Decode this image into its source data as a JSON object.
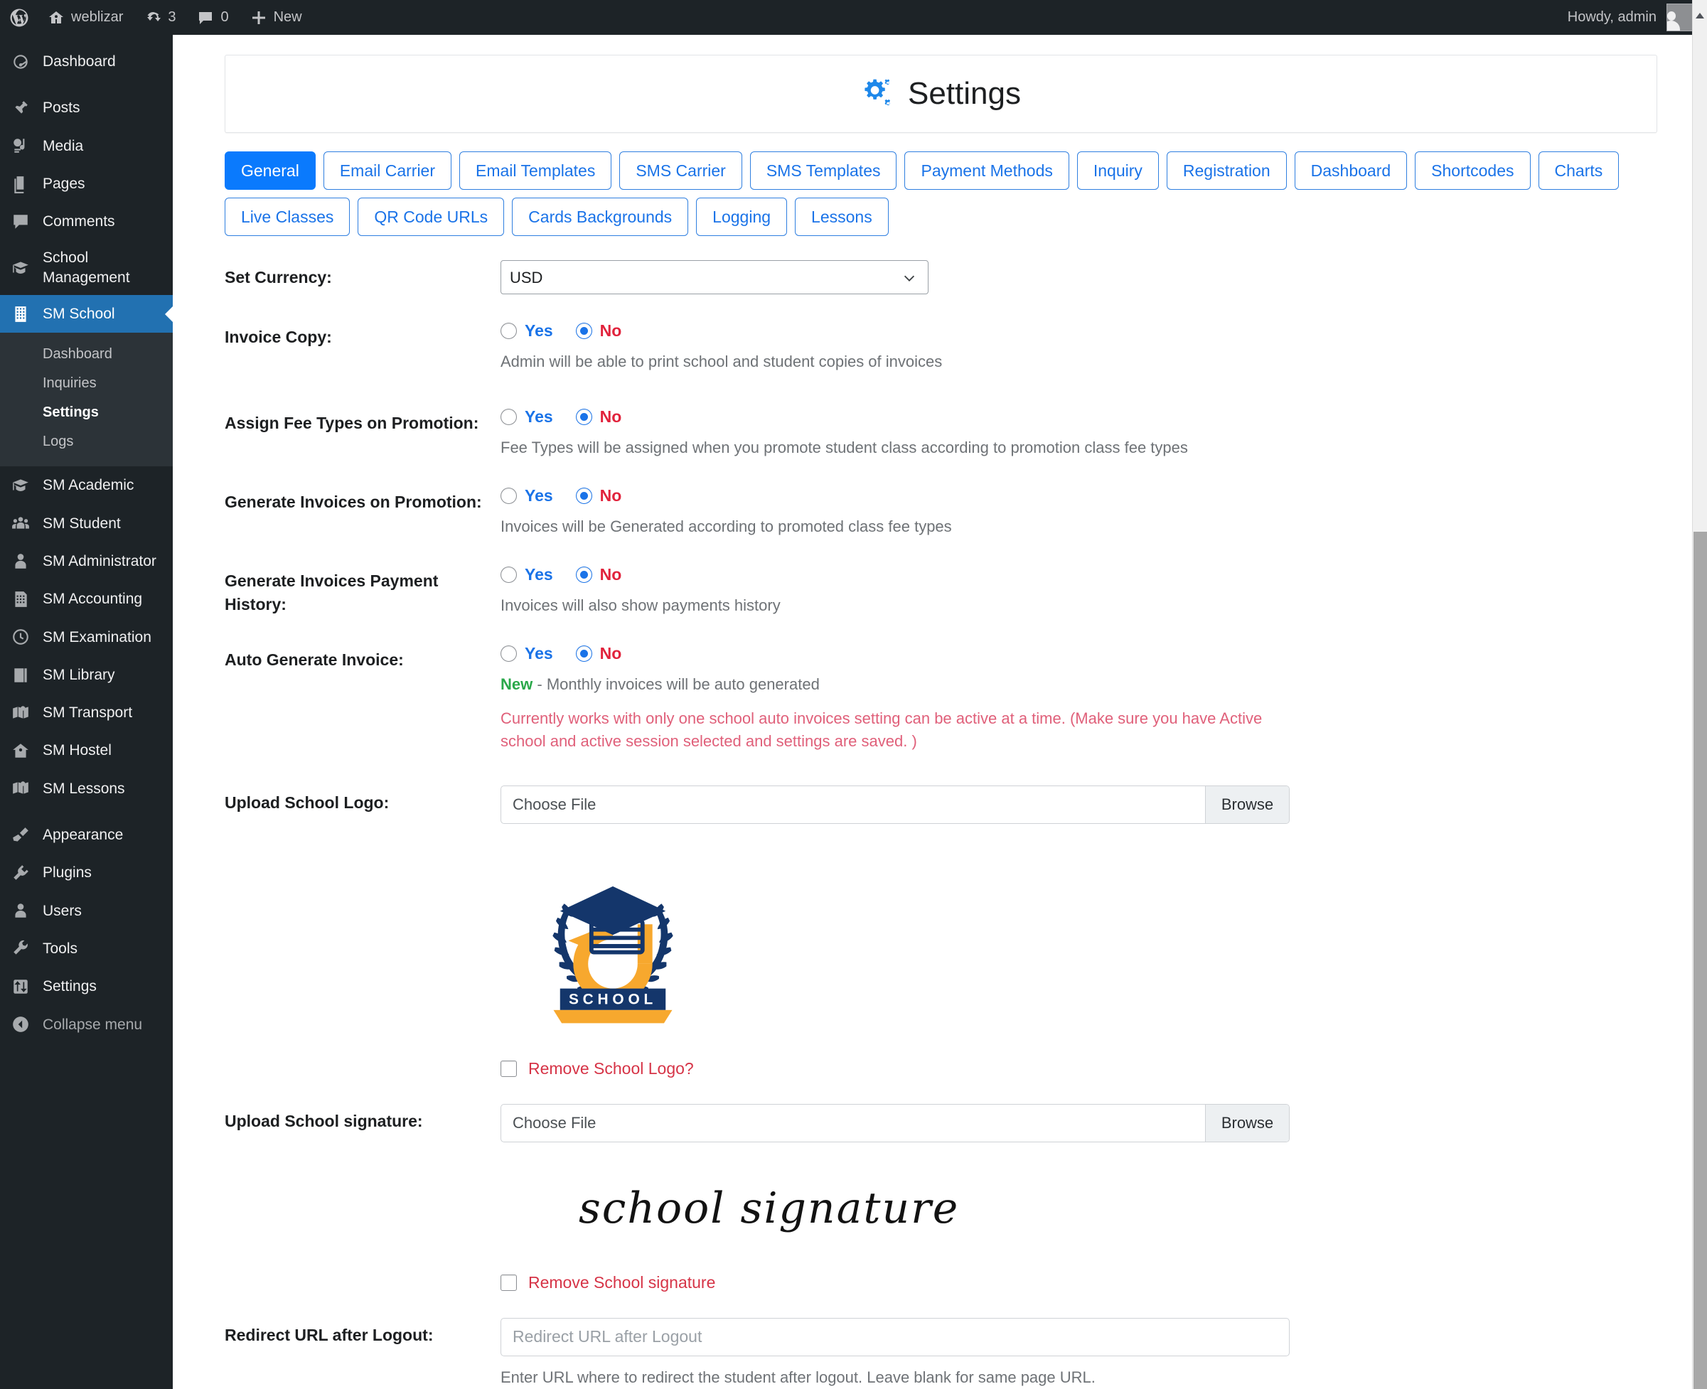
{
  "adminbar": {
    "wp_logo": "wordpress-icon",
    "site_name": "weblizar",
    "updates_count": "3",
    "comments_count": "0",
    "new_label": "New",
    "howdy": "Howdy, admin"
  },
  "sidebar": {
    "items": [
      {
        "label": "Dashboard",
        "icon": "dashboard-icon",
        "current": false
      },
      {
        "label": "Posts",
        "icon": "pin-icon",
        "current": false
      },
      {
        "label": "Media",
        "icon": "media-icon",
        "current": false
      },
      {
        "label": "Pages",
        "icon": "pages-icon",
        "current": false
      },
      {
        "label": "Comments",
        "icon": "comments-icon",
        "current": false
      },
      {
        "label": "School Management",
        "icon": "graduation-cap-icon",
        "current": false
      },
      {
        "label": "SM School",
        "icon": "building-icon",
        "current": true
      },
      {
        "label": "SM Academic",
        "icon": "graduation-cap-icon",
        "current": false
      },
      {
        "label": "SM Student",
        "icon": "users-icon",
        "current": false
      },
      {
        "label": "SM Administrator",
        "icon": "user-tie-icon",
        "current": false
      },
      {
        "label": "SM Accounting",
        "icon": "ledger-icon",
        "current": false
      },
      {
        "label": "SM Examination",
        "icon": "clock-icon",
        "current": false
      },
      {
        "label": "SM Library",
        "icon": "book-icon",
        "current": false
      },
      {
        "label": "SM Transport",
        "icon": "map-pin-icon",
        "current": false
      },
      {
        "label": "SM Hostel",
        "icon": "home-icon",
        "current": false
      },
      {
        "label": "SM Lessons",
        "icon": "map-pin-icon",
        "current": false
      },
      {
        "label": "Appearance",
        "icon": "paintbrush-icon",
        "current": false
      },
      {
        "label": "Plugins",
        "icon": "plug-icon",
        "current": false
      },
      {
        "label": "Users",
        "icon": "user-icon",
        "current": false
      },
      {
        "label": "Tools",
        "icon": "wrench-icon",
        "current": false
      },
      {
        "label": "Settings",
        "icon": "sliders-icon",
        "current": false
      },
      {
        "label": "Collapse menu",
        "icon": "collapse-icon",
        "current": false
      }
    ],
    "submenu": [
      {
        "label": "Dashboard",
        "current": false
      },
      {
        "label": "Inquiries",
        "current": false
      },
      {
        "label": "Settings",
        "current": true
      },
      {
        "label": "Logs",
        "current": false
      }
    ]
  },
  "page": {
    "title": "Settings",
    "title_icon": "gears-icon"
  },
  "tabs": {
    "row1": [
      {
        "label": "General",
        "active": true
      },
      {
        "label": "Email Carrier",
        "active": false
      },
      {
        "label": "Email Templates",
        "active": false
      },
      {
        "label": "SMS Carrier",
        "active": false
      },
      {
        "label": "SMS Templates",
        "active": false
      },
      {
        "label": "Payment Methods",
        "active": false
      },
      {
        "label": "Inquiry",
        "active": false
      },
      {
        "label": "Registration",
        "active": false
      },
      {
        "label": "Dashboard",
        "active": false
      },
      {
        "label": "Shortcodes",
        "active": false
      },
      {
        "label": "Charts",
        "active": false
      }
    ],
    "row2": [
      {
        "label": "Live Classes",
        "active": false
      },
      {
        "label": "QR Code URLs",
        "active": false
      },
      {
        "label": "Cards Backgrounds",
        "active": false
      },
      {
        "label": "Logging",
        "active": false
      },
      {
        "label": "Lessons",
        "active": false
      }
    ]
  },
  "form": {
    "currency": {
      "label": "Set Currency:",
      "value": "USD",
      "options": [
        "USD"
      ]
    },
    "yes_label": "Yes",
    "no_label": "No",
    "invoice_copy": {
      "label": "Invoice Copy:",
      "selected": "No",
      "help": "Admin will be able to print school and student copies of invoices"
    },
    "assign_fee_types": {
      "label": "Assign Fee Types on Promotion:",
      "selected": "No",
      "help": "Fee Types will be assigned when you promote student class according to promotion class fee types"
    },
    "generate_invoices_promotion": {
      "label": "Generate Invoices on Promotion:",
      "selected": "No",
      "help": "Invoices will be Generated according to promoted class fee types"
    },
    "generate_invoices_payment_history": {
      "label": "Generate Invoices Payment History:",
      "selected": "No",
      "help": "Invoices will also show payments history"
    },
    "auto_generate_invoice": {
      "label": "Auto Generate Invoice:",
      "selected": "No",
      "new_tag": "New",
      "help": "- Monthly invoices will be auto generated",
      "warning": "Currently works with only one school auto invoices setting can be active at a time. (Make sure you have Active school and active session selected and settings are saved. )"
    },
    "upload_logo": {
      "label": "Upload School Logo:",
      "file_value": "Choose File",
      "browse_label": "Browse",
      "logo_alt": "school-logo",
      "logo_text": "SCHOOL",
      "remove_label": "Remove School Logo?",
      "remove_checked": false
    },
    "upload_signature": {
      "label": "Upload School signature:",
      "file_value": "Choose File",
      "browse_label": "Browse",
      "signature_text": "school signature",
      "remove_label": "Remove School signature",
      "remove_checked": false
    },
    "redirect_url": {
      "label": "Redirect URL after Logout:",
      "value": "",
      "placeholder": "Redirect URL after Logout",
      "help": "Enter URL where to redirect the student after logout. Leave blank for same page URL."
    }
  },
  "colors": {
    "accent_blue": "#0a7afd",
    "link_blue": "#1a73e8",
    "danger_red": "#d63447",
    "success_green": "#2aa84a",
    "admin_dark": "#1d2327",
    "menu_current": "#2271b1"
  }
}
